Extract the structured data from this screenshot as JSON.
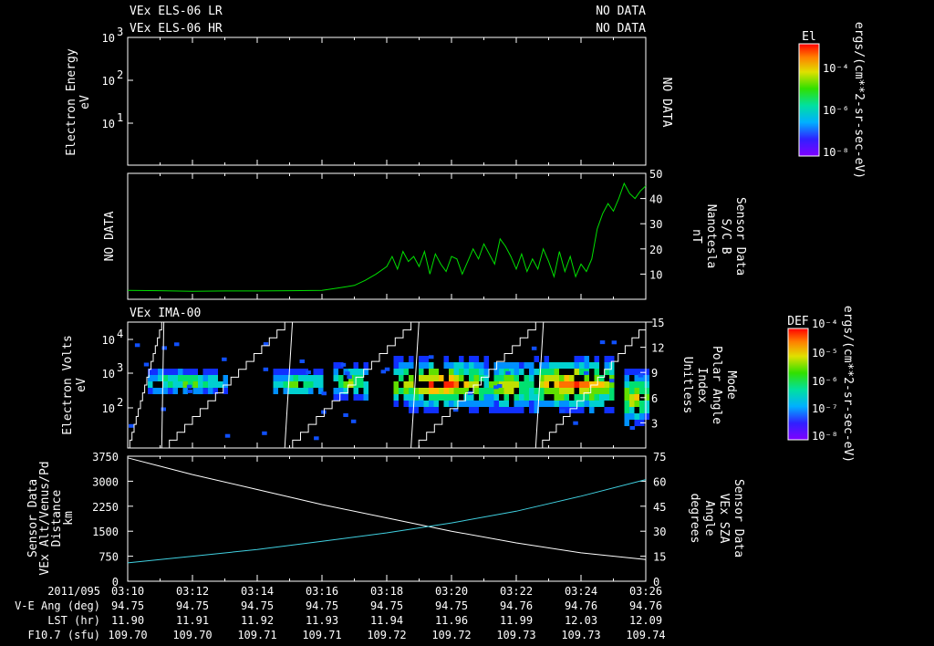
{
  "header": {
    "lr_label": "VEx ELS-06 LR",
    "hr_label": "VEx ELS-06 HR",
    "lr_status": "NO DATA",
    "hr_status": "NO DATA"
  },
  "panel1": {
    "ylabel1": "Electron Energy",
    "ylabel2": "eV",
    "yticks": [
      "10",
      "10",
      "10"
    ],
    "yexps": [
      "3",
      "2",
      "1"
    ],
    "right_status": "NO DATA",
    "colorbar": {
      "title": "El",
      "ticks": [
        "10⁻⁴",
        "10⁻⁶",
        "10⁻⁸"
      ],
      "unit": "ergs/(cm**2-sr-sec-eV)"
    }
  },
  "panel2": {
    "left_status": "NO DATA",
    "right_labels": [
      "Sensor Data",
      "S/C B",
      "Nanotesla",
      "nT"
    ],
    "color": "#00e000"
  },
  "panel3": {
    "title": "VEx IMA-00",
    "ylabel1": "Electron Volts",
    "ylabel2": "eV",
    "yticks": [
      "10",
      "10",
      "10"
    ],
    "yexps": [
      "4",
      "3",
      "2"
    ],
    "right_labels": [
      "Mode",
      "Polar Angle",
      "Index",
      "Unitless"
    ],
    "colorbar": {
      "title": "DEF",
      "ticks": [
        "10⁻⁴",
        "10⁻⁵",
        "10⁻⁶",
        "10⁻⁷",
        "10⁻⁸"
      ],
      "unit": "ergs/(cm**2-sr-sec-eV)"
    }
  },
  "panel4": {
    "left_labels": [
      "Sensor Data",
      "VEx Alt/Venus/Pd",
      "Distance",
      "km"
    ],
    "right_labels": [
      "Sensor Data",
      "VEx SZA",
      "Angle",
      "degrees"
    ],
    "color_alt": "#ffffff",
    "color_sza": "#40d0e0"
  },
  "footer": {
    "row_labels": [
      "2011/095",
      "V-E Ang (deg)",
      "LST (hr)",
      "F10.7 (sfu)"
    ],
    "times": [
      "03:10",
      "03:12",
      "03:14",
      "03:16",
      "03:18",
      "03:20",
      "03:22",
      "03:24",
      "03:26"
    ],
    "ve_ang": [
      "94.75",
      "94.75",
      "94.75",
      "94.75",
      "94.75",
      "94.75",
      "94.76",
      "94.76",
      "94.76"
    ],
    "lst": [
      "11.90",
      "11.91",
      "11.92",
      "11.93",
      "11.94",
      "11.96",
      "11.99",
      "12.03",
      "12.09"
    ],
    "f107": [
      "109.70",
      "109.70",
      "109.71",
      "109.71",
      "109.72",
      "109.72",
      "109.73",
      "109.73",
      "109.74"
    ]
  },
  "chart_data": [
    {
      "type": "heatmap",
      "title": "VEx ELS-06 LR / VEx ELS-06 HR",
      "ylabel": "Electron Energy eV",
      "yscale": "log",
      "ylim": [
        1,
        1000
      ],
      "status": "NO DATA"
    },
    {
      "type": "line",
      "ylabel": "Sensor Data S/C B Nanotesla nT",
      "ylim": [
        0,
        50
      ],
      "yticks": [
        10,
        20,
        30,
        40,
        50
      ],
      "x": [
        "03:10",
        "03:11",
        "03:12",
        "03:13",
        "03:14",
        "03:15",
        "03:16",
        "03:16:30",
        "03:17",
        "03:17:20",
        "03:17:40",
        "03:18",
        "03:18:10",
        "03:18:20",
        "03:18:30",
        "03:18:40",
        "03:18:50",
        "03:19",
        "03:19:10",
        "03:19:20",
        "03:19:30",
        "03:19:40",
        "03:19:50",
        "03:20",
        "03:20:10",
        "03:20:20",
        "03:20:30",
        "03:20:40",
        "03:20:50",
        "03:21",
        "03:21:10",
        "03:21:20",
        "03:21:30",
        "03:21:40",
        "03:21:50",
        "03:22",
        "03:22:10",
        "03:22:20",
        "03:22:30",
        "03:22:40",
        "03:22:50",
        "03:23",
        "03:23:10",
        "03:23:20",
        "03:23:30",
        "03:23:40",
        "03:23:50",
        "03:24",
        "03:24:10",
        "03:24:20",
        "03:24:30",
        "03:24:40",
        "03:24:50",
        "03:25",
        "03:25:10",
        "03:25:20",
        "03:25:30",
        "03:25:40",
        "03:25:50",
        "03:26"
      ],
      "values": [
        3.5,
        3.4,
        3.2,
        3.3,
        3.3,
        3.4,
        3.5,
        4.5,
        5.5,
        7.5,
        10,
        13,
        17,
        12,
        19,
        15,
        17,
        13,
        19,
        10,
        18,
        14,
        11,
        17,
        16,
        10,
        15,
        20,
        16,
        22,
        18,
        14,
        24,
        21,
        17,
        12,
        18,
        11,
        16,
        12,
        20,
        15,
        9,
        19,
        11,
        17,
        9,
        14,
        11,
        16,
        28,
        34,
        38,
        35,
        40,
        46,
        42,
        40,
        43,
        45
      ],
      "color": "#00e000"
    },
    {
      "type": "heatmap",
      "title": "VEx IMA-00",
      "ylabel": "Electron Volts eV",
      "yscale": "log",
      "ylim": [
        10,
        30000
      ],
      "secondary": {
        "ylabel": "Mode Polar Angle Index Unitless",
        "ylim": [
          0,
          15
        ],
        "yticks": [
          3,
          6,
          9,
          12,
          15
        ]
      }
    },
    {
      "type": "line",
      "x": [
        "03:10",
        "03:12",
        "03:14",
        "03:16",
        "03:18",
        "03:20",
        "03:22",
        "03:24",
        "03:26"
      ],
      "series": [
        {
          "name": "Sensor Data VEx Alt/Venus/Pd Distance km",
          "axis": "left",
          "values": [
            3700,
            3200,
            2750,
            2300,
            1900,
            1500,
            1150,
            850,
            650
          ]
        },
        {
          "name": "Sensor Data VEx SZA Angle degrees",
          "axis": "right",
          "values": [
            11,
            15,
            19,
            24,
            29,
            35,
            42,
            51,
            61
          ]
        }
      ],
      "ylim_left": [
        0,
        3750
      ],
      "yticks_left": [
        0,
        750,
        1500,
        2250,
        3000,
        3750
      ],
      "ylim_right": [
        0,
        75
      ],
      "yticks_right": [
        0,
        15,
        30,
        45,
        60,
        75
      ]
    }
  ]
}
